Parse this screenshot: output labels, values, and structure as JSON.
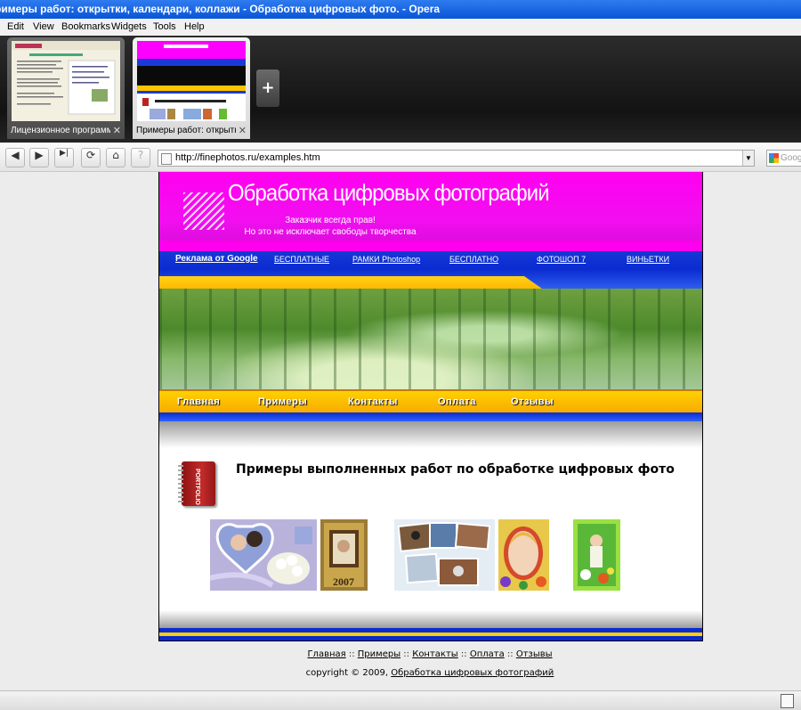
{
  "window": {
    "title": "римеры работ: открытки, календари, коллажи - Обработка цифровых фото. - Opera"
  },
  "menu": [
    "Edit",
    "View",
    "Bookmarks",
    "Widgets",
    "Tools",
    "Help"
  ],
  "tabs": [
    {
      "label": "Лицензионное программно...",
      "close": "✕"
    },
    {
      "label": "Примеры работ: открытки...",
      "close": "✕"
    }
  ],
  "toolbar": {
    "new_tab": "+",
    "back": "◀",
    "forward": "▶",
    "fast_forward": "▶|",
    "reload": "⟳",
    "home": "⌂",
    "info": "?",
    "address": "http://finephotos.ru/examples.htm",
    "dropdown": "▼",
    "search_placeholder": "Google"
  },
  "site": {
    "title": "Обработка цифровых фотографий",
    "slogan_line1": "Заказчик всегда прав!",
    "slogan_line2": "Но это не исключает свободы творчества",
    "top_links": [
      "Реклама от Google",
      "БЕСПЛАТНЫЕ",
      "РАМКИ Photoshop",
      "БЕСПЛАТНО",
      "ФОТОШОП 7",
      "ВИНЬЕТКИ"
    ],
    "main_nav": [
      "Главная",
      "Примеры",
      "Контакты",
      "Оплата",
      "Отзывы"
    ],
    "portfolio_text": "PORTFOLIO",
    "page_title": "Примеры выполненных работ по обработке цифровых фото",
    "calendar_year": "2007"
  },
  "footer": {
    "links": [
      "Главная",
      "Примеры",
      "Контакты",
      "Оплата",
      "Отзывы"
    ],
    "separator": "::",
    "copyright_prefix": "copyright © 2009,",
    "copyright_link": "Обработка цифровых фотографий"
  },
  "colors": {
    "magenta": "#ff00f0",
    "blue": "#0a2bd0",
    "gold": "#ffc400"
  }
}
